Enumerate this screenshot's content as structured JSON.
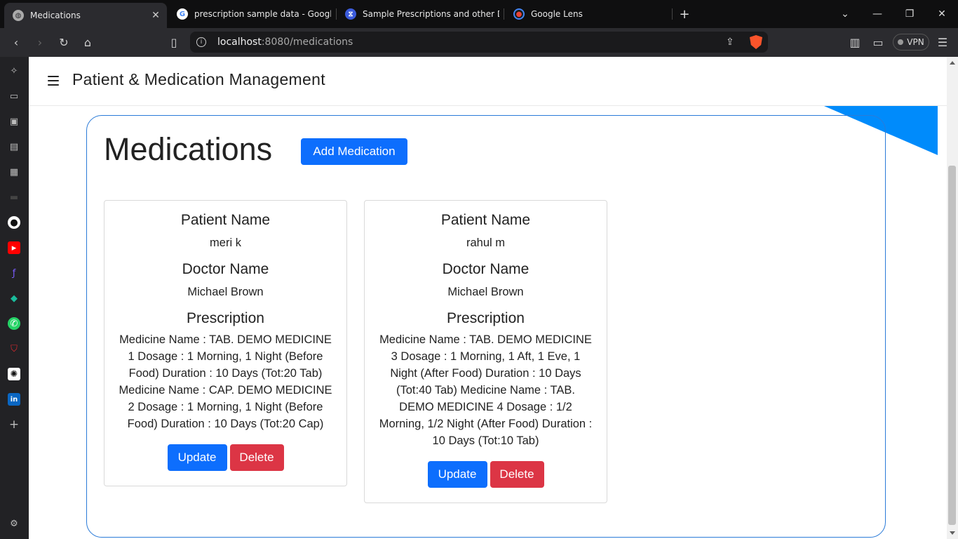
{
  "browser": {
    "tabs": [
      {
        "title": "Medications",
        "active": true,
        "icon": "globe-icon"
      },
      {
        "title": "prescription sample data - Google Se",
        "active": false,
        "icon": "google-icon"
      },
      {
        "title": "Sample Prescriptions and other Docu",
        "active": false,
        "icon": "dna-icon"
      },
      {
        "title": "Google Lens",
        "active": false,
        "icon": "lens-icon"
      }
    ],
    "url_host": "localhost",
    "url_path": ":8080/medications",
    "vpn_label": "VPN"
  },
  "app": {
    "title": "Patient & Medication Management",
    "page_heading": "Medications",
    "add_button_label": "Add Medication"
  },
  "cards": [
    {
      "patient_label": "Patient Name",
      "patient_name": "meri k",
      "doctor_label": "Doctor Name",
      "doctor_name": "Michael Brown",
      "prescription_label": "Prescription",
      "prescription_text": "Medicine Name : TAB. DEMO MEDICINE 1 Dosage : 1 Morning, 1 Night (Before Food) Duration : 10 Days (Tot:20 Tab) Medicine Name : CAP. DEMO MEDICINE 2 Dosage : 1 Morning, 1 Night (Before Food) Duration : 10 Days (Tot:20 Cap)",
      "update_label": "Update",
      "delete_label": "Delete"
    },
    {
      "patient_label": "Patient Name",
      "patient_name": "rahul m",
      "doctor_label": "Doctor Name",
      "doctor_name": "Michael Brown",
      "prescription_label": "Prescription",
      "prescription_text": "Medicine Name : TAB. DEMO MEDICINE 3 Dosage : 1 Morning, 1 Aft, 1 Eve, 1 Night (After Food) Duration : 10 Days (Tot:40 Tab) Medicine Name : TAB. DEMO MEDICINE 4 Dosage : 1/2 Morning, 1/2 Night (After Food) Duration : 10 Days (Tot:10 Tab)",
      "update_label": "Update",
      "delete_label": "Delete"
    }
  ],
  "colors": {
    "primary": "#0d6efd",
    "danger": "#dc3545",
    "panel_border": "#2b7bd8",
    "corner_accent": "#008bfb"
  }
}
